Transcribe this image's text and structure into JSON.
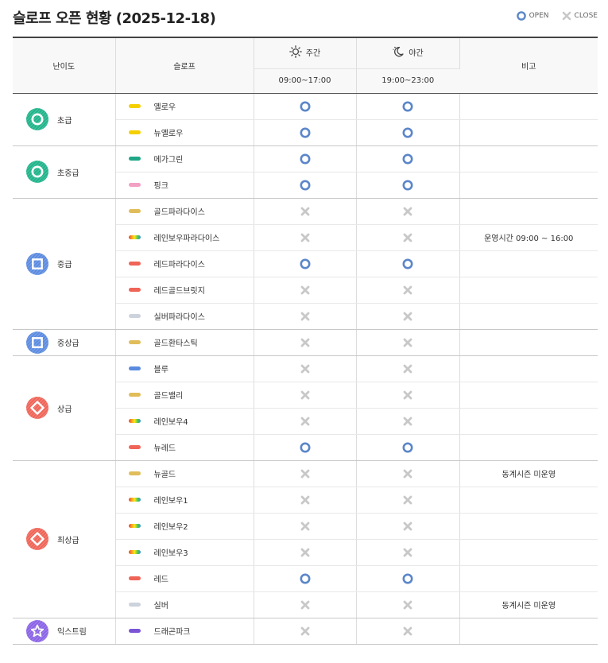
{
  "header": {
    "title": "슬로프 오픈 현황 (2025-12-18)",
    "legend_open": "OPEN",
    "legend_close": "CLOSE"
  },
  "columns": {
    "level": "난이도",
    "slope": "슬로프",
    "day": "주간",
    "night": "야간",
    "note": "비고",
    "day_time": "09:00~17:00",
    "night_time": "19:00~23:00"
  },
  "colors": {
    "open": "#5b86c9",
    "close": "#c8c8c8",
    "beginner": "#1fb48a",
    "intermediate": "#5b8be0",
    "advanced": "#ef6457",
    "extreme": "#8a63e6"
  },
  "groups": [
    {
      "level": "초급",
      "shape": "circle",
      "color": "#1fb48a",
      "icon": "circle-level-icon",
      "rows": [
        {
          "name": "옐로우",
          "bar": "yellow",
          "day": "open",
          "night": "open",
          "note": ""
        },
        {
          "name": "뉴옐로우",
          "bar": "yellow",
          "day": "open",
          "night": "open",
          "note": ""
        }
      ]
    },
    {
      "level": "초중급",
      "shape": "circle",
      "color": "#1fb48a",
      "icon": "circle-level-icon",
      "rows": [
        {
          "name": "메가그린",
          "bar": "green",
          "day": "open",
          "night": "open",
          "note": ""
        },
        {
          "name": "핑크",
          "bar": "pink",
          "day": "open",
          "night": "open",
          "note": ""
        }
      ]
    },
    {
      "level": "중급",
      "shape": "square",
      "color": "#5b8be0",
      "icon": "square-level-icon",
      "rows": [
        {
          "name": "골드파라다이스",
          "bar": "gold",
          "day": "close",
          "night": "close",
          "note": ""
        },
        {
          "name": "레인보우파라다이스",
          "bar": "rainbow",
          "day": "close",
          "night": "close",
          "note": "운영시간 09:00 ~ 16:00"
        },
        {
          "name": "레드파라다이스",
          "bar": "red",
          "day": "open",
          "night": "open",
          "note": ""
        },
        {
          "name": "레드골드브릿지",
          "bar": "red",
          "day": "close",
          "night": "close",
          "note": ""
        },
        {
          "name": "실버파라다이스",
          "bar": "silver",
          "day": "close",
          "night": "close",
          "note": ""
        }
      ]
    },
    {
      "level": "중상급",
      "shape": "square",
      "color": "#5b8be0",
      "icon": "square-level-icon",
      "rows": [
        {
          "name": "골드환타스틱",
          "bar": "gold",
          "day": "close",
          "night": "close",
          "note": ""
        }
      ]
    },
    {
      "level": "상급",
      "shape": "diamond",
      "color": "#ef6457",
      "icon": "diamond-level-icon",
      "rows": [
        {
          "name": "블루",
          "bar": "blue",
          "day": "close",
          "night": "close",
          "note": ""
        },
        {
          "name": "골드밸리",
          "bar": "gold",
          "day": "close",
          "night": "close",
          "note": ""
        },
        {
          "name": "레인보우4",
          "bar": "rainbow",
          "day": "close",
          "night": "close",
          "note": ""
        },
        {
          "name": "뉴레드",
          "bar": "red",
          "day": "open",
          "night": "open",
          "note": ""
        }
      ]
    },
    {
      "level": "최상급",
      "shape": "diamond",
      "color": "#ef6457",
      "icon": "diamond-level-icon",
      "rows": [
        {
          "name": "뉴골드",
          "bar": "gold",
          "day": "close",
          "night": "close",
          "note": "동계시즌 미운영"
        },
        {
          "name": "레인보우1",
          "bar": "rainbow",
          "day": "close",
          "night": "close",
          "note": ""
        },
        {
          "name": "레인보우2",
          "bar": "rainbow",
          "day": "close",
          "night": "close",
          "note": ""
        },
        {
          "name": "레인보우3",
          "bar": "rainbow",
          "day": "close",
          "night": "close",
          "note": ""
        },
        {
          "name": "레드",
          "bar": "red",
          "day": "open",
          "night": "open",
          "note": ""
        },
        {
          "name": "실버",
          "bar": "silver",
          "day": "close",
          "night": "close",
          "note": "동계시즌 미운영"
        }
      ]
    },
    {
      "level": "익스트림",
      "shape": "star",
      "color": "#8a63e6",
      "icon": "star-level-icon",
      "rows": [
        {
          "name": "드래곤파크",
          "bar": "purple",
          "day": "close",
          "night": "close",
          "note": ""
        }
      ]
    }
  ]
}
